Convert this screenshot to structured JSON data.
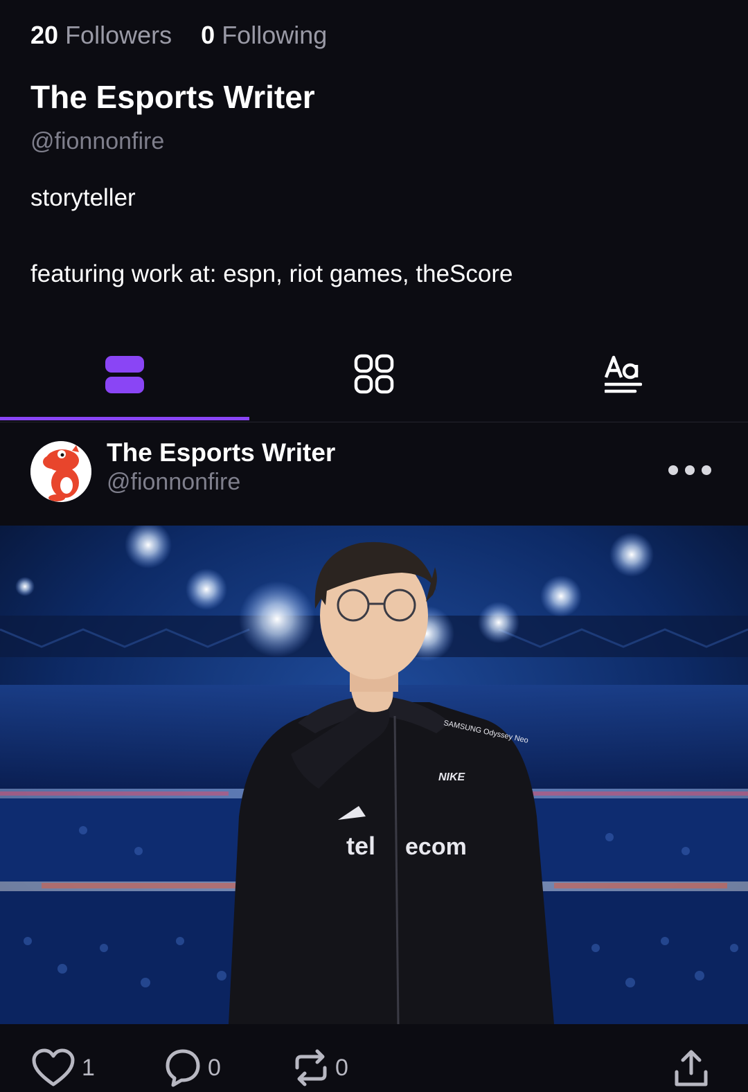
{
  "profile": {
    "followers_count": "20",
    "followers_label": "Followers",
    "following_count": "0",
    "following_label": "Following",
    "display_name": "The Esports Writer",
    "handle": "@fionnonfire",
    "bio_line1": "storyteller",
    "bio_line2": "featuring work at: espn, riot games, theScore"
  },
  "tabs": [
    {
      "icon": "posts-list-icon",
      "active": true
    },
    {
      "icon": "grid-icon",
      "active": false
    },
    {
      "icon": "text-posts-icon",
      "active": false
    }
  ],
  "post": {
    "author_name": "The Esports Writer",
    "author_handle": "@fionnonfire",
    "avatar_icon": "red-cartoon-character-avatar",
    "more_icon": "more-options-icon",
    "image_jersey_text": "tel ecom",
    "image_brand_text": "NIKE",
    "image_sponsor_text": "SAMSUNG Odyssey Neo",
    "likes": "1",
    "comments": "0",
    "reposts": "0"
  },
  "colors": {
    "background": "#0c0c12",
    "accent": "#8a45f5",
    "muted_text": "#7f7f8c"
  }
}
